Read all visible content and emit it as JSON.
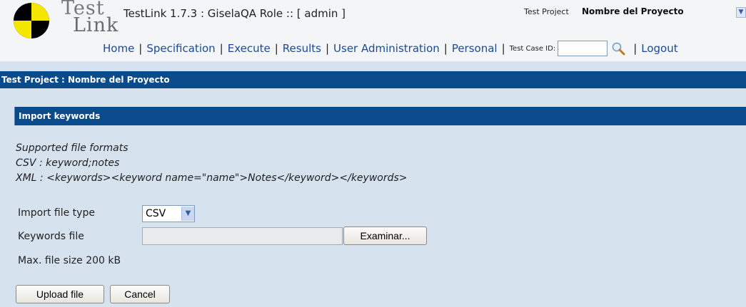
{
  "header": {
    "logo_test": "Test",
    "logo_link": "Link",
    "title": "TestLink 1.7.3 : GiselaQA Role :: [ admin ]",
    "project_label": "Test Project",
    "project_name": "Nombre del Proyecto"
  },
  "nav": {
    "items": [
      "Home",
      "Specification",
      "Execute",
      "Results",
      "User Administration",
      "Personal"
    ],
    "separator": "|",
    "testcase_id_label": "Test Case ID:",
    "logout": "Logout"
  },
  "project_bar": "Test Project : Nombre del Proyecto",
  "section": {
    "title": "Import keywords",
    "formats_heading": "Supported file formats",
    "csv_format": "CSV : keyword;notes",
    "xml_format": "XML : <keywords><keyword name=\"name\">Notes</keyword></keywords>"
  },
  "form": {
    "file_type_label": "Import file type",
    "file_type_value": "CSV",
    "keywords_file_label": "Keywords file",
    "browse_label": "Examinar...",
    "max_size": "Max. file size 200 kB"
  },
  "buttons": {
    "upload": "Upload file",
    "cancel": "Cancel"
  },
  "colors": {
    "bar_blue": "#0a4b8c",
    "body_bg": "#d6e2ee",
    "link_blue": "#1a4a96"
  }
}
